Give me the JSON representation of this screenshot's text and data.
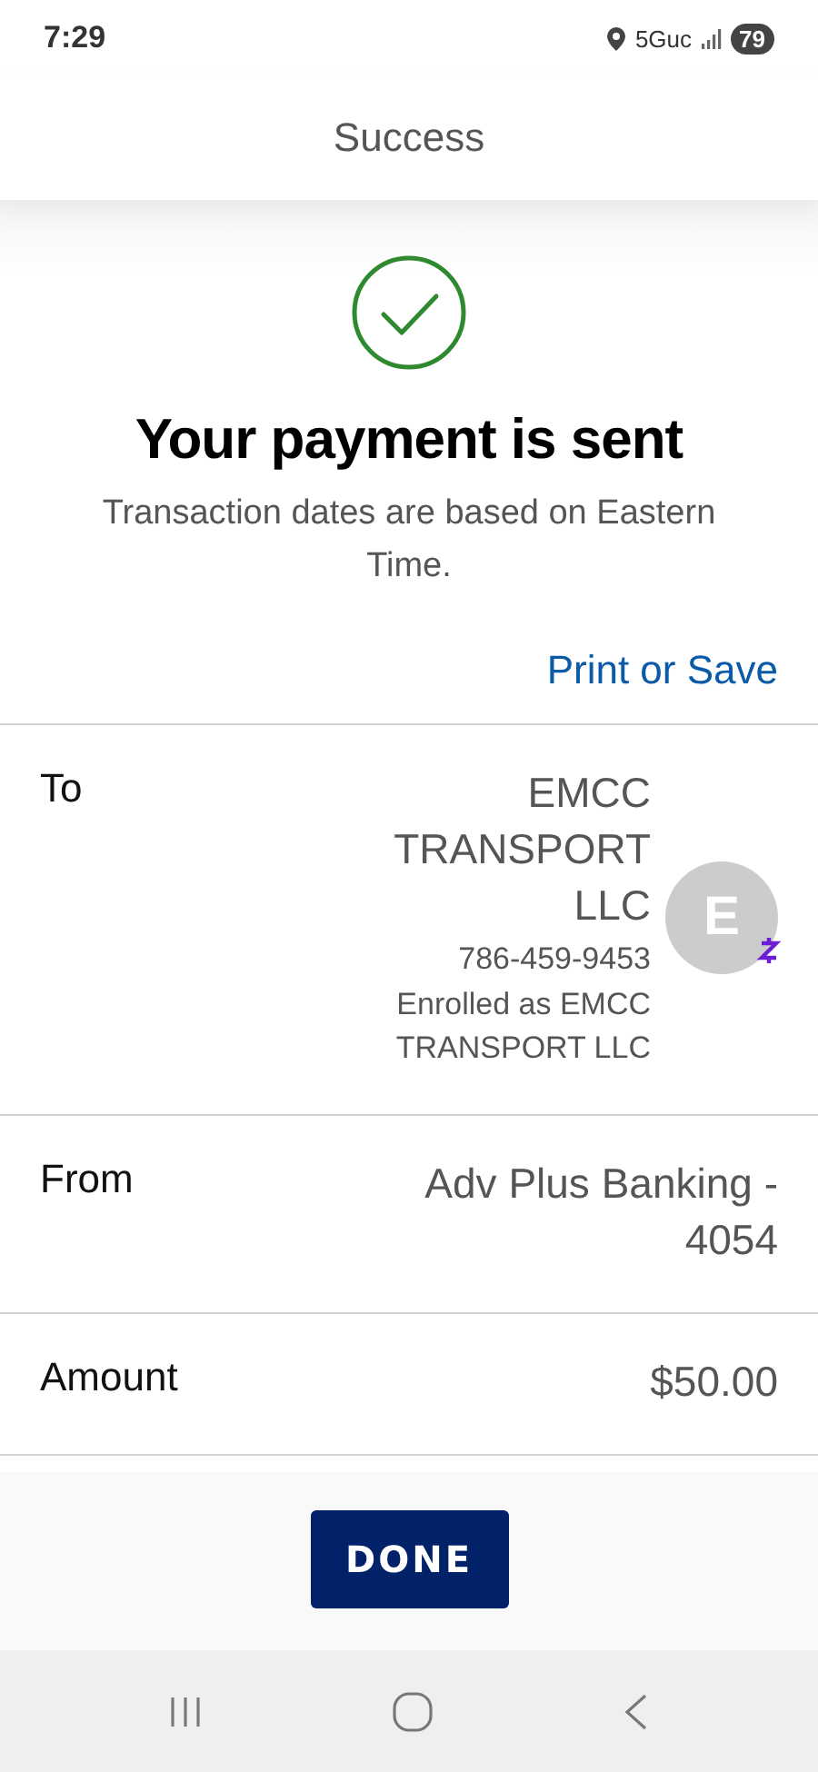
{
  "status_bar": {
    "time": "7:29",
    "network": "5Guc",
    "battery": "79"
  },
  "header": {
    "title": "Success"
  },
  "confirmation": {
    "title": "Your payment is sent",
    "subtitle": "Transaction dates are based on Eastern Time.",
    "link": "Print or Save"
  },
  "details": [
    {
      "kind": "recipient",
      "label": "To",
      "name": "EMCC TRANSPORT LLC",
      "phone": "786-459-9453",
      "note": "Enrolled as EMCC TRANSPORT LLC",
      "avatar": "E"
    },
    {
      "kind": "plain",
      "label": "From",
      "value": "Adv Plus Banking - 4054"
    },
    {
      "kind": "plain",
      "label": "Amount",
      "value": "$50.00"
    }
  ],
  "button": "DONE"
}
